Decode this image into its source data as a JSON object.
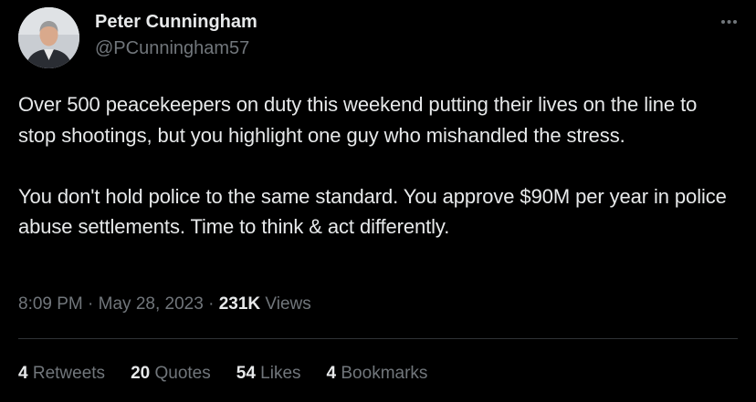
{
  "author": {
    "display_name": "Peter Cunningham",
    "handle": "@PCunningham57"
  },
  "tweet": {
    "text": "Over 500 peacekeepers on duty this weekend putting their lives on the line to stop shootings, but you highlight one guy who mishandled the stress.\n\nYou don't hold police to the same standard. You approve $90M per year in police abuse settlements. Time to think & act differently."
  },
  "meta": {
    "time": "8:09 PM",
    "separator": " · ",
    "date": "May 28, 2023",
    "views_count": "231K",
    "views_label": " Views"
  },
  "stats": {
    "retweets_count": "4",
    "retweets_label": " Retweets",
    "quotes_count": "20",
    "quotes_label": " Quotes",
    "likes_count": "54",
    "likes_label": " Likes",
    "bookmarks_count": "4",
    "bookmarks_label": " Bookmarks"
  },
  "icons": {
    "more": "more-horizontal-icon"
  },
  "colors": {
    "background": "#000000",
    "primary_text": "#e7e9ea",
    "secondary_text": "#71767b",
    "divider": "#2f3336"
  }
}
